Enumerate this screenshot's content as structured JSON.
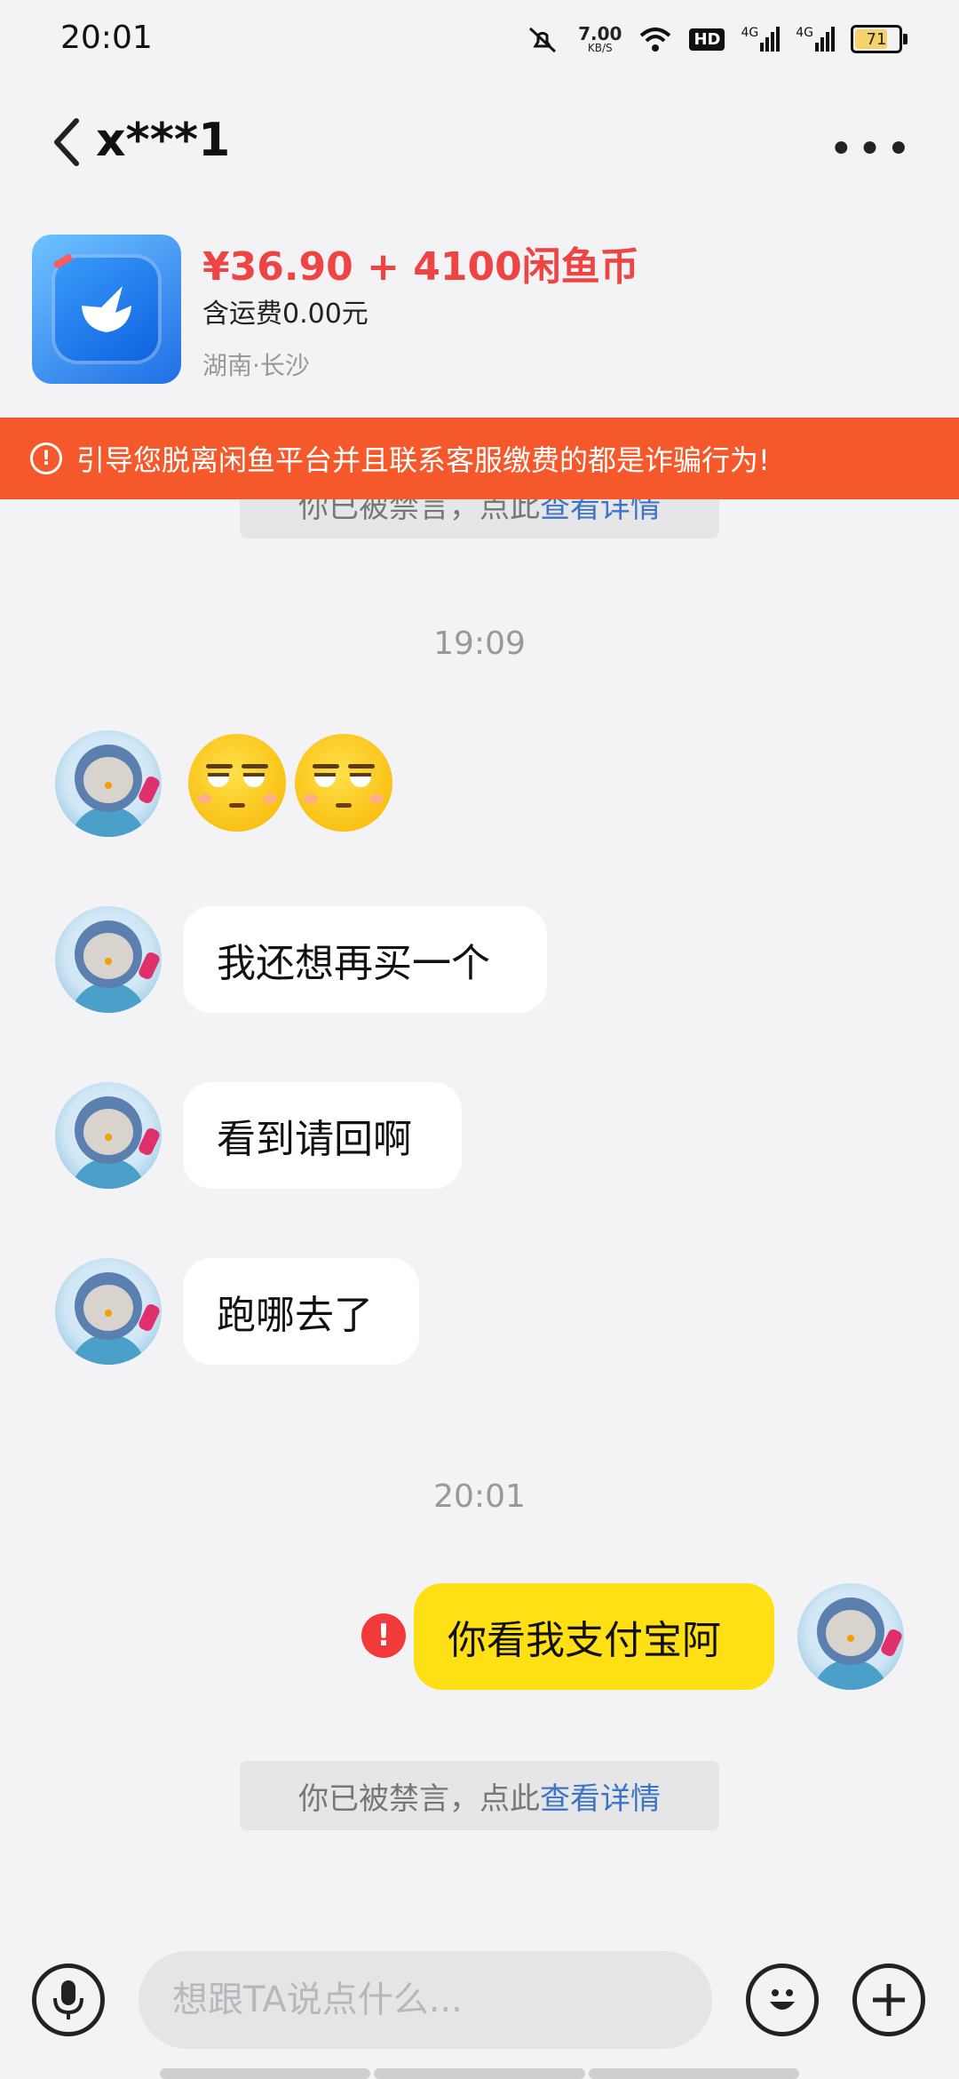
{
  "status_bar": {
    "time": "20:01",
    "speed_value": "7.00",
    "speed_unit": "KB/S",
    "network_1": "4G",
    "network_2": "4G",
    "hd_label": "HD",
    "battery": "71"
  },
  "header": {
    "title": "x***1"
  },
  "product": {
    "price": "¥36.90 + 4100闲鱼币",
    "shipping": "含运费0.00元",
    "location": "湖南·长沙"
  },
  "warning": {
    "text": "引导您脱离闲鱼平台并且联系客服缴费的都是诈骗行为!"
  },
  "notices": [
    {
      "text": "你已被禁言，点此",
      "link": "查看详情"
    },
    {
      "text": "你已被禁言，点此",
      "link": "查看详情"
    }
  ],
  "timestamps": [
    "19:09",
    "20:01"
  ],
  "messages": [
    {
      "sender": "other",
      "text": "我还想再买一个"
    },
    {
      "sender": "other",
      "text": "看到请回啊"
    },
    {
      "sender": "other",
      "text": "跑哪去了"
    },
    {
      "sender": "me",
      "text": "你看我支付宝阿"
    }
  ],
  "input": {
    "placeholder": "想跟TA说点什么..."
  },
  "colors": {
    "warning_bg": "#f5582b",
    "price": "#ee4444",
    "my_bubble": "#ffe014",
    "link": "#3d74c4"
  }
}
